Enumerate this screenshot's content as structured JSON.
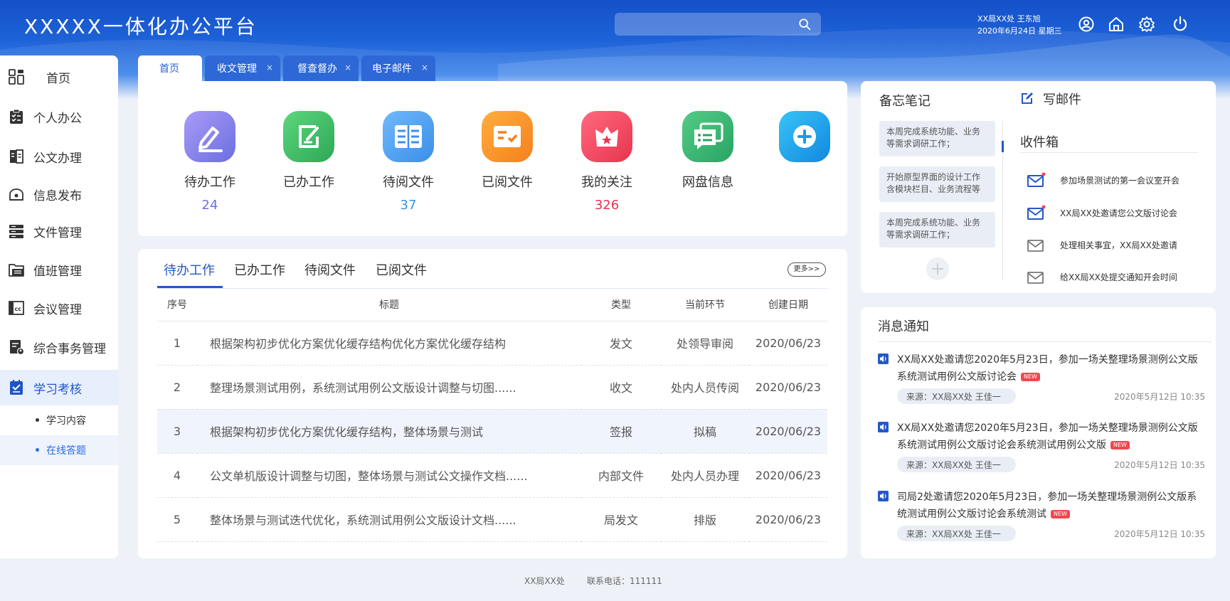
{
  "header": {
    "title": "XXXXX一体化办公平台",
    "search_placeholder": "",
    "user_org": "XX局XX处 王东旭",
    "date": "2020年6月24日 星期三"
  },
  "sidebar": {
    "items": [
      {
        "label": "首页",
        "icon": "dashboard-icon"
      },
      {
        "label": "个人办公",
        "icon": "clipboard-icon"
      },
      {
        "label": "公文办理",
        "icon": "document-icon"
      },
      {
        "label": "信息发布",
        "icon": "broadcast-icon"
      },
      {
        "label": "文件管理",
        "icon": "server-icon"
      },
      {
        "label": "值班管理",
        "icon": "folder-icon"
      },
      {
        "label": "会议管理",
        "icon": "meeting-icon"
      },
      {
        "label": "综合事务管理",
        "icon": "affairs-icon"
      },
      {
        "label": "学习考核",
        "icon": "study-icon"
      }
    ],
    "sub_items": [
      "学习内容",
      "在线答题"
    ]
  },
  "tabs": [
    {
      "label": "首页"
    },
    {
      "label": "收文管理",
      "close": "×"
    },
    {
      "label": "督查督办",
      "close": "×"
    },
    {
      "label": "电子邮件",
      "close": "×"
    }
  ],
  "shortcuts": [
    {
      "label": "待办工作",
      "count": "24",
      "color": "#6b6fe0"
    },
    {
      "label": "已办工作",
      "count": "",
      "color": "#31b35a"
    },
    {
      "label": "待阅文件",
      "count": "37",
      "color": "#3b8fe8"
    },
    {
      "label": "已阅文件",
      "count": "",
      "color": "#f5891c"
    },
    {
      "label": "我的关注",
      "count": "326",
      "color": "#e8344f"
    },
    {
      "label": "网盘信息",
      "count": "",
      "color": "#2fb06b"
    },
    {
      "label": "",
      "count": "",
      "color": "#1a9be6"
    }
  ],
  "task_tabs": [
    "待办工作",
    "已办工作",
    "待阅文件",
    "已阅文件"
  ],
  "more_label": "更多>>",
  "table": {
    "headers": [
      "序号",
      "标题",
      "类型",
      "当前环节",
      "创建日期"
    ],
    "rows": [
      [
        "1",
        "根据架构初步优化方案优化缓存结构优化方案优化缓存结构",
        "发文",
        "处领导审阅",
        "2020/06/23"
      ],
      [
        "2",
        "整理场景测试用例，系统测试用例公文版设计调整与切图......",
        "收文",
        "处内人员传阅",
        "2020/06/23"
      ],
      [
        "3",
        "根据架构初步优化方案优化缓存结构，整体场景与测试",
        "签报",
        "拟稿",
        "2020/06/23"
      ],
      [
        "4",
        "公文单机版设计调整与切图，整体场景与测试公文操作文档......",
        "内部文件",
        "处内人员办理",
        "2020/06/23"
      ],
      [
        "5",
        "整体场景与测试迭代优化，系统测试用例公文版设计文档......",
        "局发文",
        "排版",
        "2020/06/23"
      ]
    ]
  },
  "memo": {
    "title": "备忘笔记",
    "items": [
      [
        "本周完成系统功能、业务",
        "等需求调研工作；"
      ],
      [
        "开始原型界面的设计工作",
        "含模块栏目、业务流程等"
      ],
      [
        "本周完成系统功能、业务",
        "等需求调研工作；"
      ]
    ]
  },
  "mail": {
    "compose_label": "写邮件",
    "inbox_title": "收件箱",
    "items": [
      {
        "subject": "参加场景测试的第一会议室开会",
        "unread": true
      },
      {
        "subject": "XX局XX处邀请您公文版讨论会",
        "unread": true
      },
      {
        "subject": "处理相关事宜，XX局XX处邀请",
        "unread": false
      },
      {
        "subject": "给XX局XX处提交通知开会时间",
        "unread": false
      }
    ]
  },
  "notices": {
    "title": "消息通知",
    "new_label": "NEW",
    "items": [
      {
        "text": "XX局XX处邀请您2020年5月23日，参加一场关整理场景测例公文版系统测试用例公文版讨论会",
        "source": "来源：XX局XX处  王佳一",
        "time": "2020年5月12日  10:35"
      },
      {
        "text": "XX局XX处邀请您2020年5月23日，参加一场关整理场景测例公文版系统测试用例公文版讨论会系统测试用例公文版",
        "source": "来源：XX局XX处  王佳一",
        "time": "2020年5月12日  10:35"
      },
      {
        "text": "司局2处邀请您2020年5月23日，参加一场关整理场景测例公文版系统测试用例公文版讨论会系统测试",
        "source": "来源：XX局XX处  王佳一",
        "time": "2020年5月12日  10:35"
      }
    ]
  },
  "footer": {
    "org": "XX局XX处",
    "phone": "联系电话：111111"
  }
}
